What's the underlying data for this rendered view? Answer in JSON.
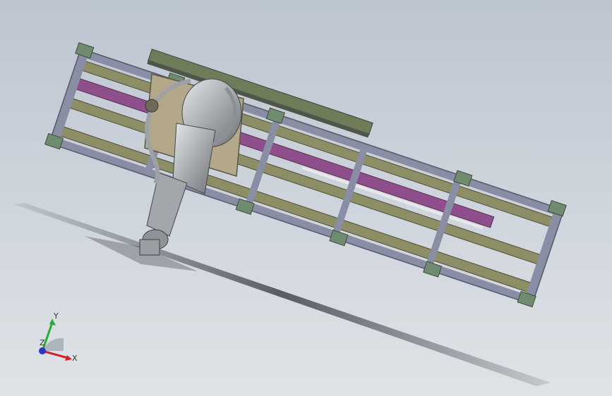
{
  "viewport": {
    "background_top": "#bcc5d0",
    "background_bottom": "#dfe3e7"
  },
  "model": {
    "frame_color": "#8a8ea4",
    "rail_color": "#8d8e66",
    "slide_color": "#8e4f8a",
    "cover_color": "#6f7c5a",
    "bracket_color": "#6f8b70",
    "robot_color": "#b9bcbf"
  },
  "triad": {
    "x_label": "X",
    "y_label": "Y",
    "z_label": "Z",
    "x_color": "#d8202a",
    "y_color": "#2bab3a",
    "z_color": "#2a36c8"
  }
}
